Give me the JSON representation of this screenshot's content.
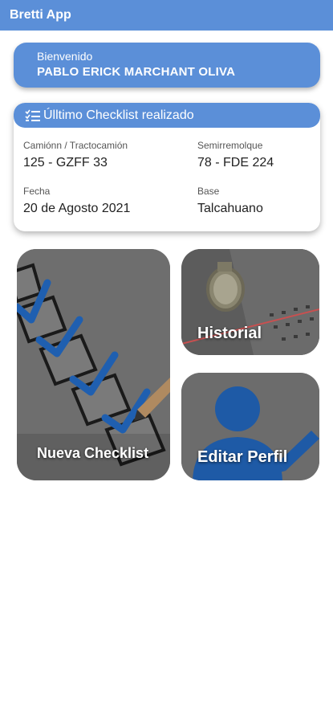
{
  "appbar": {
    "title": "Bretti App"
  },
  "welcome": {
    "greeting": "Bienvenido",
    "name": "PABLO ERICK MARCHANT OLIVA"
  },
  "checklist_card": {
    "title": "Úlltimo Checklist realizado",
    "icon": "list-check-icon",
    "fields": [
      {
        "label": "Camiónn / Tractocamión",
        "value": "125 - GZFF 33"
      },
      {
        "label": "Semirremolque",
        "value": "78 - FDE 224"
      },
      {
        "label": "Fecha",
        "value": "20 de Agosto 2021"
      },
      {
        "label": "Base",
        "value": "Talcahuano"
      }
    ]
  },
  "tiles": {
    "nueva": {
      "label": "Nueva Checklist"
    },
    "historial": {
      "label": "Historial"
    },
    "perfil": {
      "label": "Editar Perfil"
    }
  },
  "colors": {
    "primary": "#5b8fd8",
    "check_blue": "#1f5fb0",
    "profile_blue": "#1e5aa6"
  }
}
